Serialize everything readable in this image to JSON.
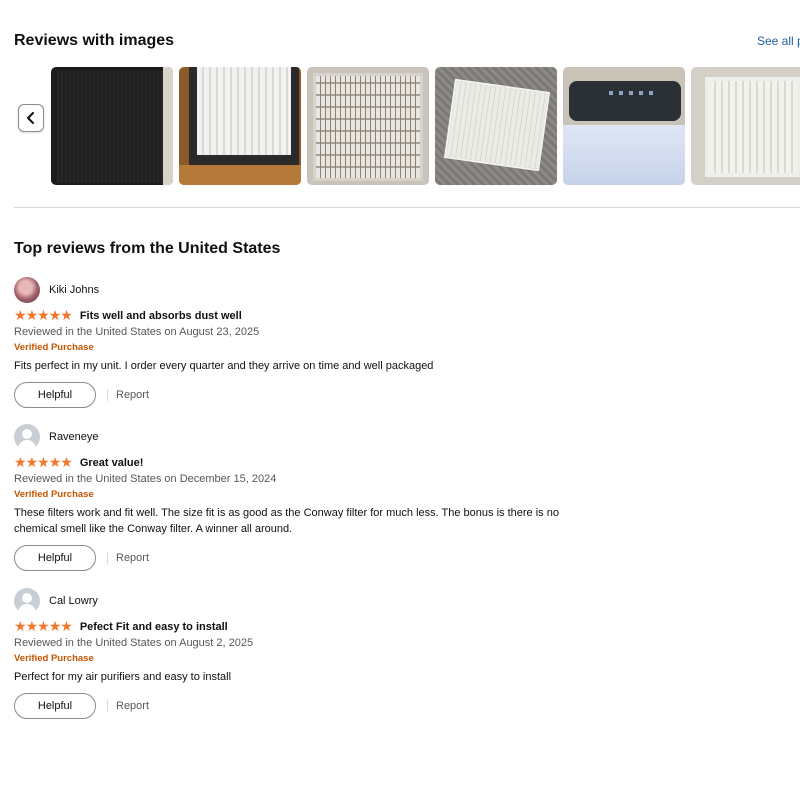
{
  "images_section": {
    "title": "Reviews with images",
    "see_all": "See all p",
    "prev_icon": "chevron-left-icon",
    "thumbnails": [
      {
        "subject": "dark carbon filter"
      },
      {
        "subject": "white filter in purifier"
      },
      {
        "subject": "pleated filter grid"
      },
      {
        "subject": "filter on carpet"
      },
      {
        "subject": "purifier with filters"
      },
      {
        "subject": "open purifier"
      }
    ]
  },
  "reviews_section": {
    "title": "Top reviews from the United States",
    "star_color": "#f2772b",
    "verified_color": "#c45500",
    "reviews": [
      {
        "author": "Kiki Johns",
        "avatar": "photo",
        "rating": 5,
        "title": "Fits well and absorbs dust well",
        "meta": "Reviewed in the United States on August 23, 2025",
        "verified": "Verified Purchase",
        "body": "Fits perfect in my unit. I order every quarter and they arrive on time and well packaged",
        "helpful": "Helpful",
        "report": "Report"
      },
      {
        "author": "Raveneye",
        "avatar": "default-user-icon",
        "rating": 5,
        "title": "Great value!",
        "meta": "Reviewed in the United States on December 15, 2024",
        "verified": "Verified Purchase",
        "body": "These filters work and fit well. The size fit is as good as the Conway filter for much less. The bonus is there is no chemical smell like the Conway filter. A winner all around.",
        "helpful": "Helpful",
        "report": "Report"
      },
      {
        "author": "Cal Lowry",
        "avatar": "default-user-icon",
        "rating": 5,
        "title": "Pefect Fit and easy to install",
        "meta": "Reviewed in the United States on August 2, 2025",
        "verified": "Verified Purchase",
        "body": "Perfect for my air purifiers and easy to install",
        "helpful": "Helpful",
        "report": "Report"
      }
    ]
  }
}
